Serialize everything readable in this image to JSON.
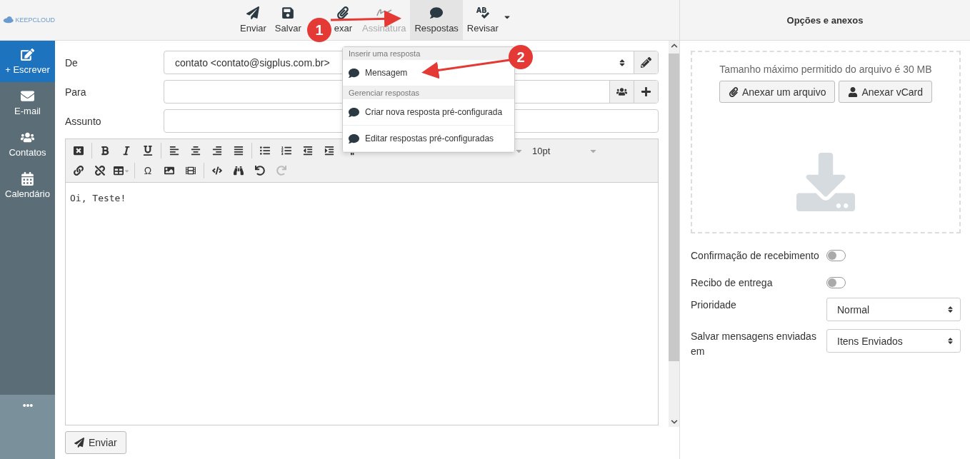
{
  "logo": {
    "text": "KEEPCLOUD"
  },
  "toolbar": [
    {
      "label": "Enviar",
      "disabled": false,
      "selected": false
    },
    {
      "label": "Salvar",
      "disabled": false,
      "selected": false
    },
    {
      "label": "exar",
      "disabled": false,
      "selected": false
    },
    {
      "label": "Assinatura",
      "disabled": true,
      "selected": false
    },
    {
      "label": "Respostas",
      "disabled": false,
      "selected": true
    },
    {
      "label": "Revisar",
      "disabled": false,
      "selected": false
    }
  ],
  "sidebar": {
    "items": [
      {
        "label": "+ Escrever",
        "selected": true
      },
      {
        "label": "E-mail",
        "selected": false
      },
      {
        "label": "Contatos",
        "selected": false
      },
      {
        "label": "Calendário",
        "selected": false
      }
    ]
  },
  "form": {
    "from": {
      "label": "De",
      "value": "contato <contato@sigplus.com.br>"
    },
    "to": {
      "label": "Para"
    },
    "subject": {
      "label": "Assunto"
    }
  },
  "editor": {
    "row_1": [
      {
        "disabled": false
      },
      {
        "disabled": false
      },
      {
        "disabled": false
      },
      {
        "disabled": false
      },
      {
        "disabled": false
      },
      {
        "disabled": false
      },
      {
        "disabled": false
      },
      {
        "disabled": false
      },
      {
        "disabled": false
      },
      {
        "disabled": false
      },
      {
        "disabled": false
      },
      {
        "disabled": false
      },
      {
        "disabled": false
      }
    ],
    "font_size": "10pt",
    "row_2": [
      {
        "disabled": false
      },
      {
        "disabled": false
      },
      {
        "disabled": false
      },
      {
        "glyph": "Ω",
        "disabled": false
      },
      {
        "disabled": false
      },
      {
        "disabled": false
      },
      {
        "disabled": false
      },
      {
        "disabled": false
      },
      {
        "disabled": false
      },
      {
        "disabled": true
      }
    ],
    "body": "Oi, Teste!"
  },
  "send_button": "Enviar",
  "responses_menu": {
    "sections": [
      {
        "header": "Inserir uma resposta",
        "items": [
          "Mensagem"
        ]
      },
      {
        "header": "Gerenciar respostas",
        "items": [
          "Criar nova resposta pré-configurada",
          "Editar respostas pré-configuradas"
        ]
      }
    ]
  },
  "annotations": [
    "1",
    "2"
  ],
  "options_panel": {
    "title": "Opções e anexos",
    "limit_note": "Tamanho máximo permitido do arquivo é 30 MB",
    "buttons": [
      "Anexar um arquivo",
      "Anexar vCard"
    ],
    "toggles": [
      {
        "label": "Confirmação de recebimento",
        "on": false
      },
      {
        "label": "Recibo de entrega",
        "on": false
      }
    ],
    "selects": [
      {
        "label": "Prioridade",
        "value": "Normal"
      },
      {
        "label": "Salvar mensagens enviadas em",
        "value": "Itens Enviados"
      }
    ]
  }
}
